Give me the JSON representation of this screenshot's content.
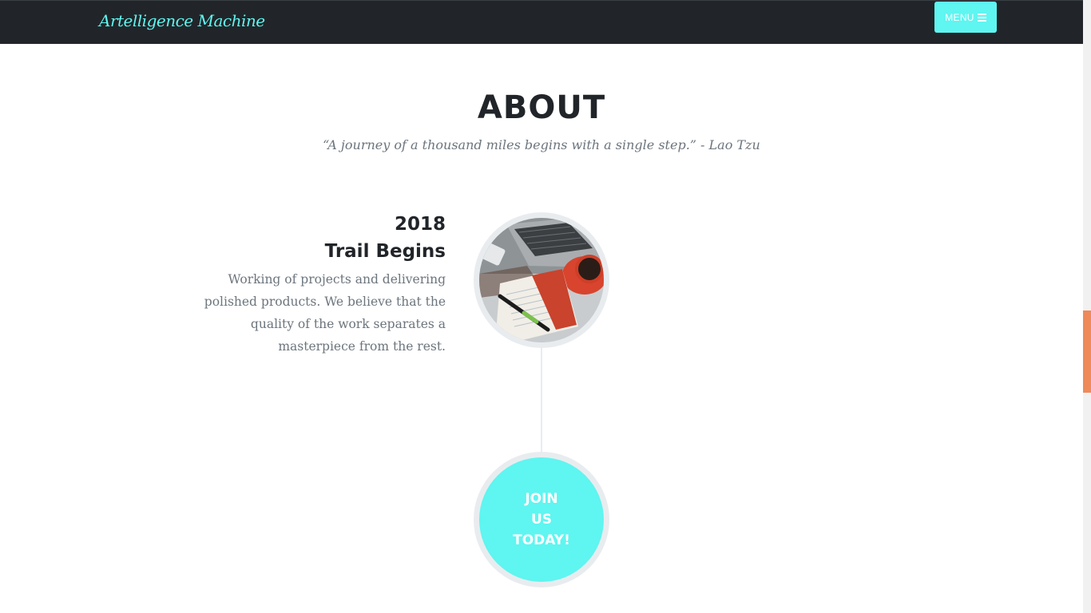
{
  "navbar": {
    "brand": "Artelligence Machine",
    "menu_label": "MENU",
    "menu_icon": "hamburger-icon"
  },
  "about": {
    "title": "ABOUT",
    "quote": "“A journey of a thousand miles begins with a single step.” - Lao Tzu"
  },
  "timeline": {
    "items": [
      {
        "year": "2018",
        "title": "Trail Begins",
        "body": "Working of projects and delivering polished products. We believe that the quality of the work separates a masterpiece from the rest.",
        "image": "desk-workspace-photo"
      }
    ],
    "cta": {
      "line1": "JOIN",
      "line2": "US",
      "line3": "TODAY!"
    }
  },
  "colors": {
    "accent": "#5ff5f0",
    "navbar": "#212529",
    "scroll_thumb": "#ef8a5b"
  }
}
